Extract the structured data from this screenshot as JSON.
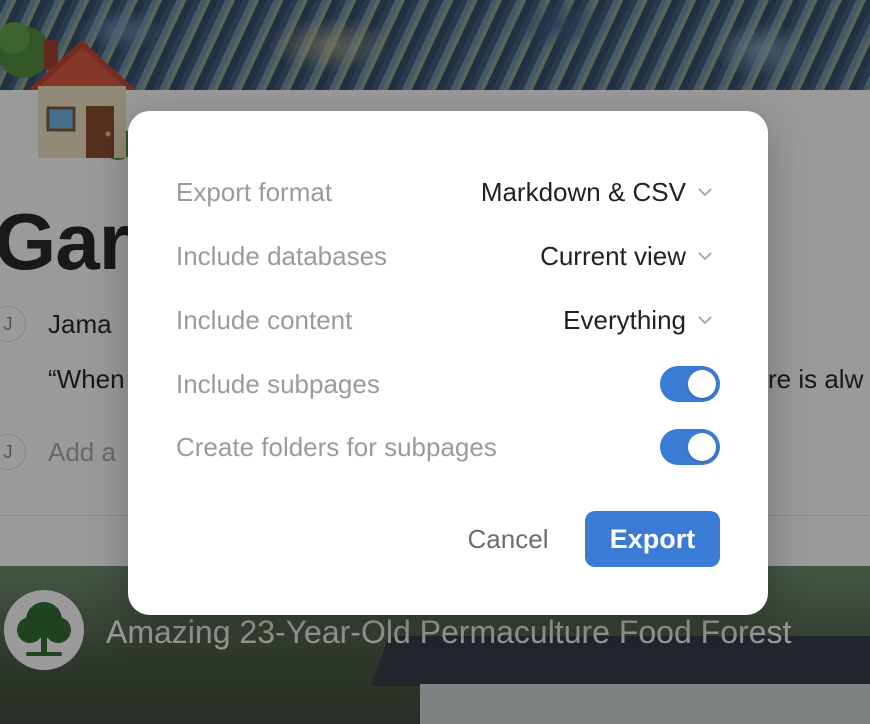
{
  "page": {
    "title": "Garden",
    "comment": {
      "avatar_initial": "J",
      "author": "Jama",
      "text_start": "“When",
      "text_end": "re is alw"
    },
    "add_comment": {
      "avatar_initial": "J",
      "placeholder": "Add a"
    },
    "embed": {
      "title": "Amazing 23-Year-Old Permaculture Food Forest"
    }
  },
  "export_dialog": {
    "options": [
      {
        "label": "Export format",
        "value": "Markdown & CSV",
        "type": "dropdown"
      },
      {
        "label": "Include databases",
        "value": "Current view",
        "type": "dropdown"
      },
      {
        "label": "Include content",
        "value": "Everything",
        "type": "dropdown"
      },
      {
        "label": "Include subpages",
        "type": "toggle",
        "on": true
      },
      {
        "label": "Create folders for subpages",
        "type": "toggle",
        "on": true
      }
    ],
    "cancel_label": "Cancel",
    "export_label": "Export"
  },
  "colors": {
    "accent": "#3a7bd5",
    "label": "#9b9b9b",
    "text": "#222222",
    "overlay": "rgba(15,15,15,0.42)"
  },
  "icons": [
    "house-emoji-icon",
    "tree-icon",
    "chevron-down-icon",
    "toggle-switch"
  ]
}
